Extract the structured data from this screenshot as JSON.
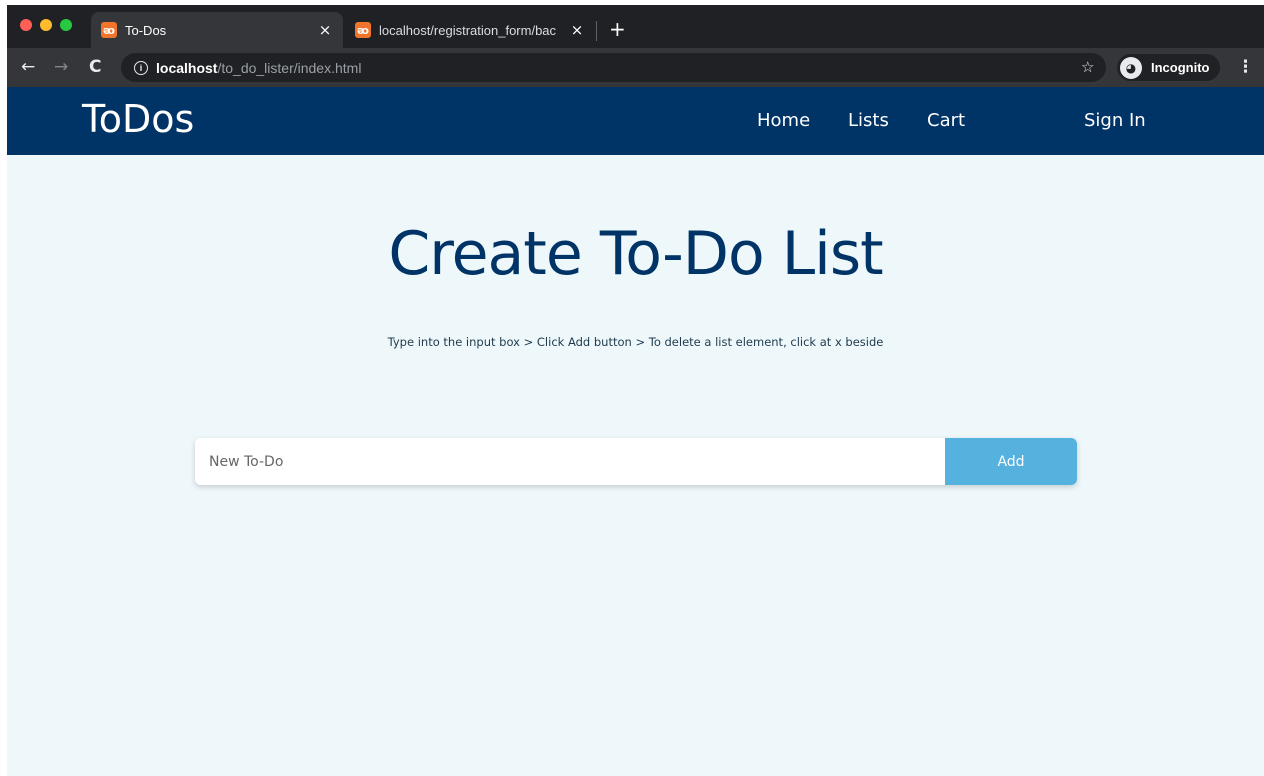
{
  "browser": {
    "traffic_lights": [
      "#ff5f57",
      "#febc2e",
      "#28c840"
    ],
    "tabs": [
      {
        "title": "To-Dos",
        "favicon": "xampp-icon",
        "active": true
      },
      {
        "title": "localhost/registration_form/bac",
        "favicon": "xampp-icon",
        "active": false
      }
    ],
    "close_glyph": "×",
    "new_tab_glyph": "+",
    "url_host": "localhost",
    "url_path": "/to_do_lister/index.html",
    "incognito_label": "Incognito"
  },
  "site": {
    "brand": "ToDos",
    "nav": [
      {
        "label": "Home"
      },
      {
        "label": "Lists"
      },
      {
        "label": "Cart"
      },
      {
        "label": "Sign In"
      }
    ],
    "colors": {
      "nav_bg": "#003366",
      "page_bg": "#eef8fb",
      "button": "#55b1de"
    }
  },
  "main": {
    "title": "Create To-Do List",
    "hint": "Type into the input box > Click Add button > To delete a list element, click at x beside",
    "input_placeholder": "New To-Do",
    "input_value": "",
    "add_label": "Add"
  }
}
